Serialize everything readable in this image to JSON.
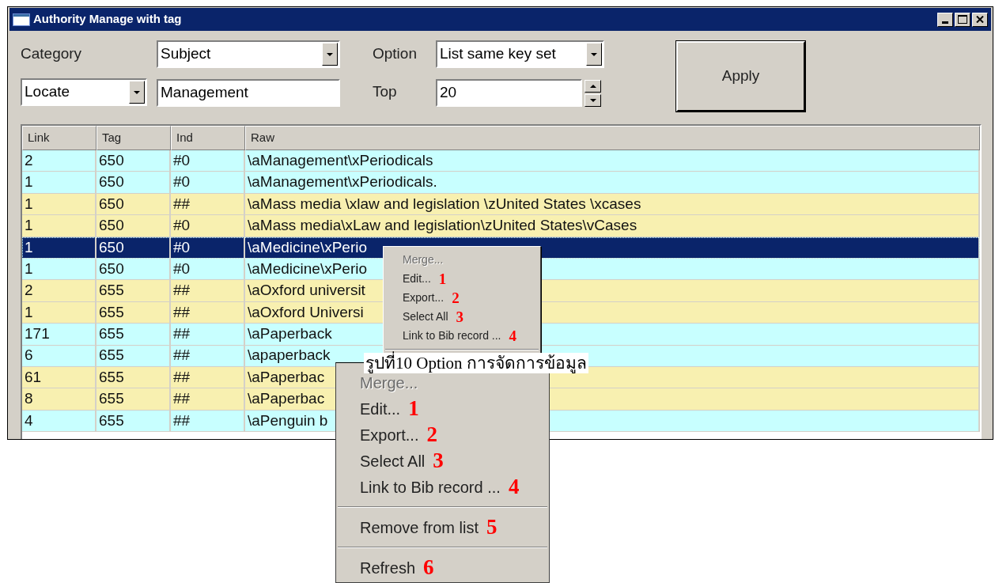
{
  "window": {
    "title": "Authority Manage with tag"
  },
  "form": {
    "category_label": "Category",
    "category_value": "Subject",
    "mode_value": "Locate",
    "search_value": "Management",
    "option_label": "Option",
    "option_value": "List same key set",
    "top_label": "Top",
    "top_value": "20",
    "apply_button": "Apply"
  },
  "table": {
    "columns": [
      "Link",
      "Tag",
      "Ind",
      "Raw"
    ],
    "rows": [
      {
        "cells": [
          "2",
          "650",
          "#0",
          "\\aManagement\\xPeriodicals"
        ],
        "color": "#c8ffff",
        "selected": false
      },
      {
        "cells": [
          "1",
          "650",
          "#0",
          "\\aManagement\\xPeriodicals."
        ],
        "color": "#c8ffff",
        "selected": false
      },
      {
        "cells": [
          "1",
          "650",
          "##",
          "\\aMass media \\xlaw and legislation \\zUnited States \\xcases"
        ],
        "color": "#f8f0b0",
        "selected": false
      },
      {
        "cells": [
          "1",
          "650",
          "#0",
          "\\aMass media\\xLaw and legislation\\zUnited States\\vCases"
        ],
        "color": "#f8f0b0",
        "selected": false
      },
      {
        "cells": [
          "1",
          "650",
          "#0",
          "\\aMedicine\\xPerio"
        ],
        "color": "#c8ffff",
        "selected": true
      },
      {
        "cells": [
          "1",
          "650",
          "#0",
          "\\aMedicine\\xPerio"
        ],
        "color": "#c8ffff",
        "selected": false
      },
      {
        "cells": [
          "2",
          "655",
          "##",
          "\\aOxford universit"
        ],
        "color": "#f8f0b0",
        "selected": false
      },
      {
        "cells": [
          "1",
          "655",
          "##",
          "\\aOxford Universi"
        ],
        "color": "#f8f0b0",
        "selected": false
      },
      {
        "cells": [
          "171",
          "655",
          "##",
          "\\aPaperback"
        ],
        "color": "#c8ffff",
        "selected": false
      },
      {
        "cells": [
          "6",
          "655",
          "##",
          "\\apaperback"
        ],
        "color": "#c8ffff",
        "selected": false
      },
      {
        "cells": [
          "61",
          "655",
          "##",
          "\\aPaperbac"
        ],
        "color": "#f8f0b0",
        "selected": false
      },
      {
        "cells": [
          "8",
          "655",
          "##",
          "\\aPaperbac"
        ],
        "color": "#f8f0b0",
        "selected": false
      },
      {
        "cells": [
          "4",
          "655",
          "##",
          "\\aPenguin b"
        ],
        "color": "#c8ffff",
        "selected": false
      }
    ]
  },
  "small_menu": {
    "items": [
      {
        "kind": "item",
        "label": "Merge...",
        "disabled": true
      },
      {
        "kind": "item",
        "label": "Edit...",
        "disabled": false,
        "annotation": "1"
      },
      {
        "kind": "item",
        "label": "Export...",
        "disabled": false,
        "annotation": "2"
      },
      {
        "kind": "item",
        "label": "Select All",
        "disabled": false,
        "annotation": "3"
      },
      {
        "kind": "item",
        "label": "Link to Bib record ...",
        "disabled": false,
        "annotation": "4"
      },
      {
        "kind": "separator"
      }
    ]
  },
  "caption": "รูปที่10 Option การจัดการข้อมูล",
  "large_menu": {
    "items": [
      {
        "kind": "item",
        "label": "Merge...",
        "disabled": true
      },
      {
        "kind": "item",
        "label": "Edit...",
        "disabled": false,
        "annotation": "1"
      },
      {
        "kind": "item",
        "label": "Export...",
        "disabled": false,
        "annotation": "2"
      },
      {
        "kind": "item",
        "label": "Select All",
        "disabled": false,
        "annotation": "3"
      },
      {
        "kind": "item",
        "label": "Link to Bib record ...",
        "disabled": false,
        "annotation": "4"
      },
      {
        "kind": "separator"
      },
      {
        "kind": "item",
        "label": "Remove from list",
        "disabled": false,
        "annotation": "5"
      },
      {
        "kind": "separator"
      },
      {
        "kind": "item",
        "label": "Refresh",
        "disabled": false,
        "annotation": "6"
      }
    ]
  }
}
